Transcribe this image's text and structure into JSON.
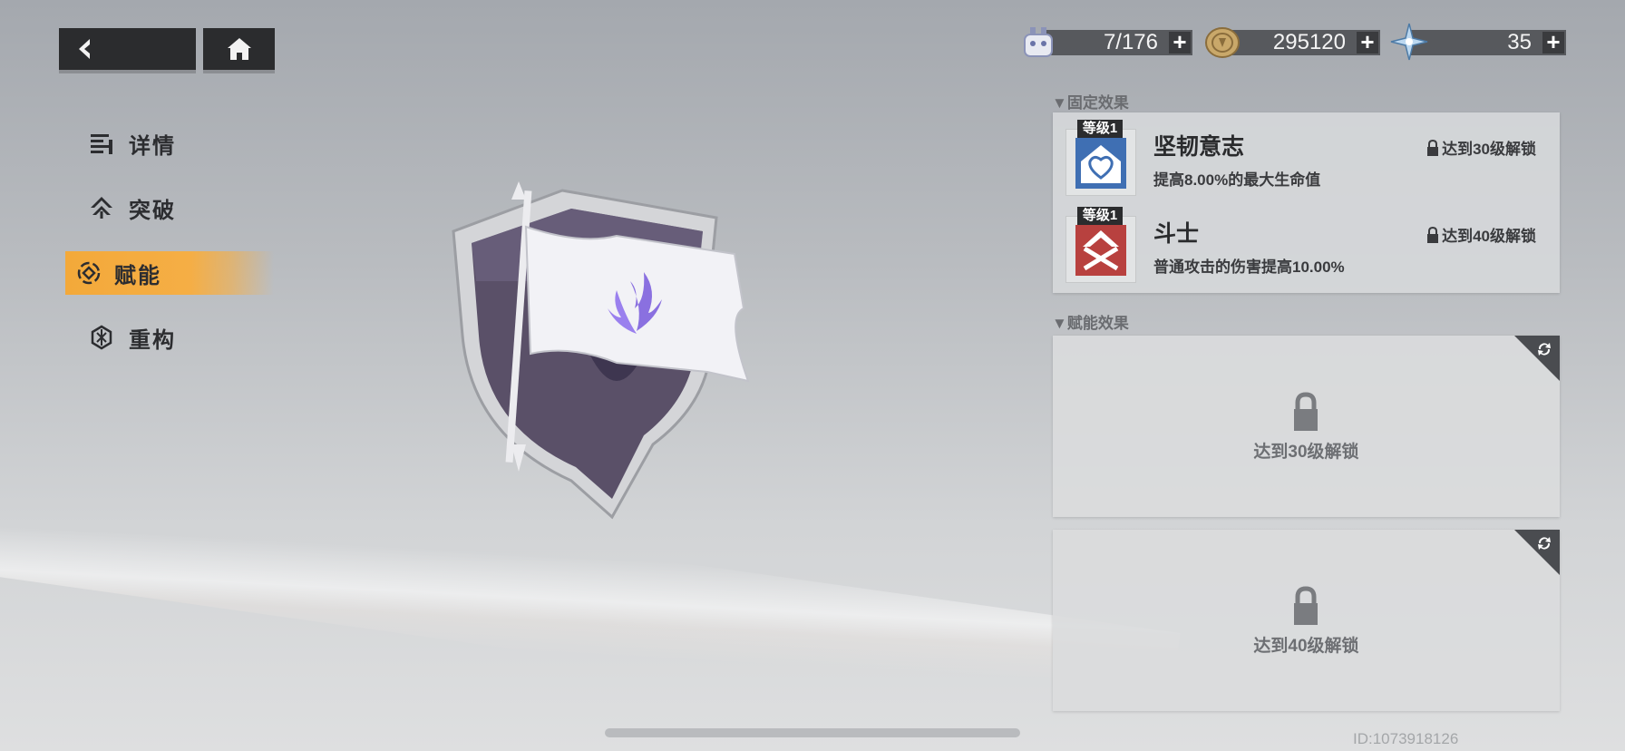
{
  "nav": {
    "back_icon": "back-arrow-icon",
    "home_icon": "home-icon"
  },
  "menu": {
    "items": [
      {
        "label": "详情",
        "icon": "details-icon",
        "active": false
      },
      {
        "label": "突破",
        "icon": "breakthrough-icon",
        "active": false
      },
      {
        "label": "赋能",
        "icon": "empower-icon",
        "active": true
      },
      {
        "label": "重构",
        "icon": "reconstruct-icon",
        "active": false
      }
    ]
  },
  "resources": [
    {
      "icon": "stamina-icon",
      "value": "7/176"
    },
    {
      "icon": "coin-icon",
      "value": "295120"
    },
    {
      "icon": "crystal-icon",
      "value": "35"
    }
  ],
  "fixed_effects": {
    "header": "▼固定效果",
    "items": [
      {
        "level": "等级1",
        "name": "坚韧意志",
        "desc": "提高8.00%的最大生命值",
        "unlock": "达到30级解锁",
        "icon": "heart-shield-icon",
        "color": "#3f6fb3"
      },
      {
        "level": "等级1",
        "name": "斗士",
        "desc": "普通攻击的伤害提高10.00%",
        "unlock": "达到40级解锁",
        "icon": "crossed-swords-icon",
        "color": "#b8413f"
      }
    ]
  },
  "empower_effects": {
    "header": "▼赋能效果",
    "cards": [
      {
        "unlock": "达到30级解锁"
      },
      {
        "unlock": "达到40级解锁"
      }
    ]
  },
  "player_id": "ID:1073918126",
  "accent_color": "#f3a93a"
}
